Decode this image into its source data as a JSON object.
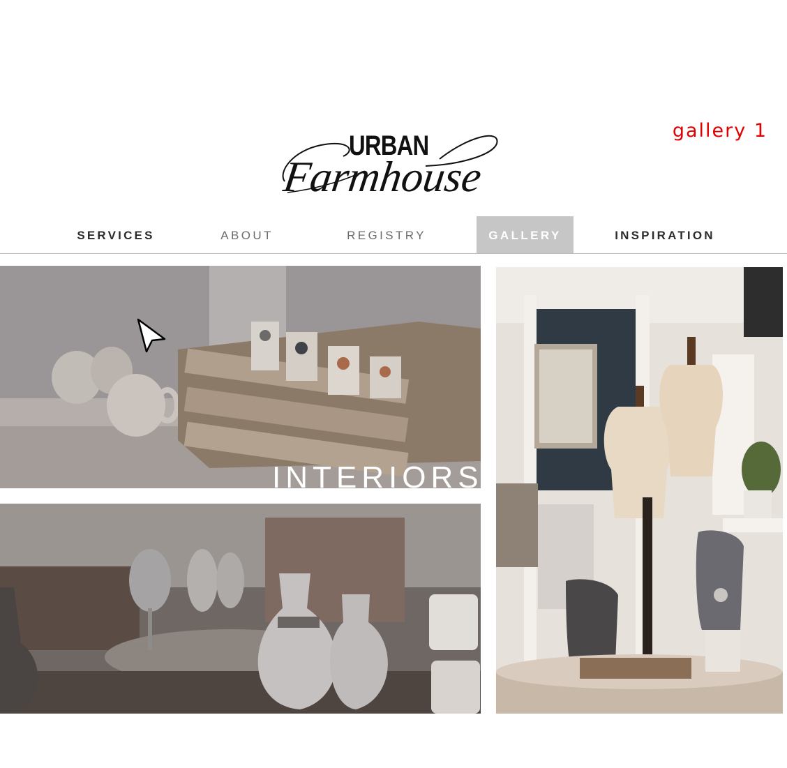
{
  "brand": {
    "logo_top": "URBAN",
    "logo_script": "Farmhouse"
  },
  "page_label": "gallery 1",
  "nav": {
    "items": [
      {
        "label": "SERVICES"
      },
      {
        "label": "ABOUT"
      },
      {
        "label": "REGISTRY"
      },
      {
        "label": "GALLERY"
      },
      {
        "label": "INSPIRATION"
      }
    ],
    "active_index": 3
  },
  "gallery": {
    "tiles": [
      {
        "caption": "INTERIORS"
      },
      {
        "caption": ""
      },
      {
        "caption": ""
      }
    ]
  },
  "colors": {
    "accent_red": "#e00000",
    "nav_active_bg": "#c6c6c6"
  }
}
